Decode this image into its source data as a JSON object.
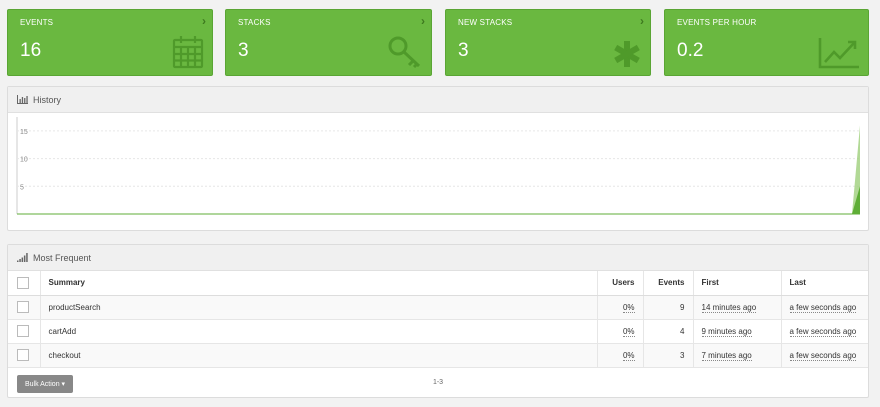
{
  "tiles": [
    {
      "label": "EVENTS",
      "value": "16",
      "icon": "calendar-icon"
    },
    {
      "label": "STACKS",
      "value": "3",
      "icon": "key-icon"
    },
    {
      "label": "NEW STACKS",
      "value": "3",
      "icon": "asterisk-icon"
    },
    {
      "label": "EVENTS PER HOUR",
      "value": "0.2",
      "icon": "line-chart-icon"
    }
  ],
  "tile_chevron": "›",
  "colors": {
    "tile_green": "#6ab840",
    "chart_line": "#5fae37",
    "chart_fill": "#9fd07c"
  },
  "history": {
    "title": "History",
    "icon": "bar-chart-icon"
  },
  "chart_data": {
    "type": "area",
    "yticks": [
      "15",
      "10",
      "5"
    ],
    "ylim": [
      0,
      17.5
    ],
    "x": [
      "start",
      "end"
    ],
    "series": [
      {
        "values": [
          0,
          0,
          16
        ]
      },
      {
        "values": [
          0,
          0,
          5
        ]
      }
    ],
    "grid": true
  },
  "most_frequent": {
    "title": "Most Frequent",
    "icon": "signal-icon",
    "columns": {
      "summary": "Summary",
      "users": "Users",
      "events": "Events",
      "first": "First",
      "last": "Last"
    },
    "rows": [
      {
        "summary": "productSearch",
        "users": "0%",
        "events": "9",
        "first": "14 minutes ago",
        "last": "a few seconds ago"
      },
      {
        "summary": "cartAdd",
        "users": "0%",
        "events": "4",
        "first": "9 minutes ago",
        "last": "a few seconds ago"
      },
      {
        "summary": "checkout",
        "users": "0%",
        "events": "3",
        "first": "7 minutes ago",
        "last": "a few seconds ago"
      }
    ],
    "bulk_action": "Bulk Action ▾",
    "pagination": "1-3"
  }
}
